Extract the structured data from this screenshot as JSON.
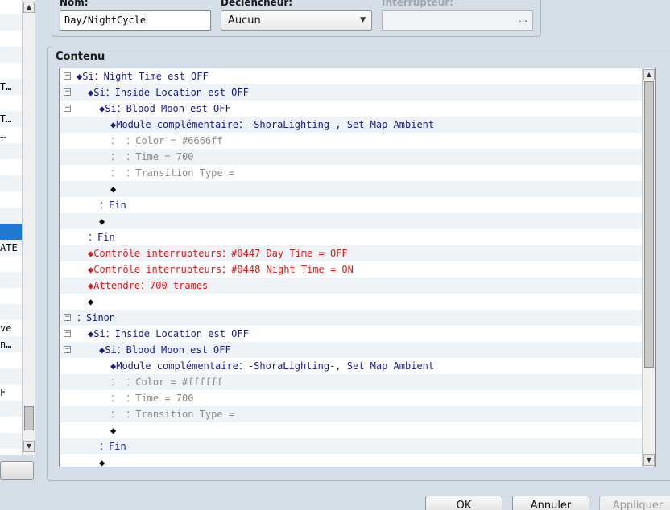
{
  "left_list": {
    "rows": [
      "",
      "",
      "",
      "",
      "",
      "T…",
      "",
      "T…",
      "…",
      "",
      "",
      "",
      "",
      "",
      "",
      "ATE",
      "",
      "",
      "",
      "",
      "ve",
      "n…",
      "",
      "",
      "F",
      "",
      "",
      ""
    ],
    "selected_index": 14
  },
  "fields": {
    "name_label": "Nom:",
    "name_value": "Day/NightCycle",
    "trigger_label": "Déclencheur:",
    "trigger_value": "Aucun",
    "switch_label": "Interrupteur:",
    "switch_button": "…"
  },
  "content": {
    "title": "Contenu",
    "rows": [
      {
        "fold": "minus",
        "fold_indent": 0,
        "text_indent": 0,
        "color": "blue",
        "text": "◆Si：Night Time est OFF"
      },
      {
        "fold": "minus",
        "fold_indent": 0,
        "text_indent": 1,
        "color": "blue",
        "text": "◆Si：Inside Location est OFF"
      },
      {
        "fold": "minus",
        "fold_indent": 0,
        "text_indent": 2,
        "color": "blue",
        "text": "◆Si：Blood Moon est OFF"
      },
      {
        "fold": "",
        "text_indent": 3,
        "color": "blue",
        "text": "◆Module complémentaire：-ShoraLighting-, Set Map Ambient"
      },
      {
        "fold": "",
        "text_indent": 3,
        "color": "gray",
        "text": "：                      ：Color = #6666ff"
      },
      {
        "fold": "",
        "text_indent": 3,
        "color": "gray",
        "text": "：                      ：Time = 700"
      },
      {
        "fold": "",
        "text_indent": 3,
        "color": "gray",
        "text": "：                      ：Transition Type ="
      },
      {
        "fold": "",
        "text_indent": 3,
        "color": "black",
        "text": "◆"
      },
      {
        "fold": "",
        "text_indent": 2,
        "color": "blue",
        "text": "：Fin"
      },
      {
        "fold": "",
        "text_indent": 2,
        "color": "black",
        "text": "◆"
      },
      {
        "fold": "",
        "text_indent": 1,
        "color": "blue",
        "text": "：Fin"
      },
      {
        "fold": "",
        "text_indent": 1,
        "color": "red",
        "text": "◆Contrôle interrupteurs：#0447 Day Time = OFF"
      },
      {
        "fold": "",
        "text_indent": 1,
        "color": "red",
        "text": "◆Contrôle interrupteurs：#0448 Night Time = ON"
      },
      {
        "fold": "",
        "text_indent": 1,
        "color": "red",
        "text": "◆Attendre：700 trames"
      },
      {
        "fold": "",
        "text_indent": 1,
        "color": "black",
        "text": "◆"
      },
      {
        "fold": "minus",
        "fold_indent": 0,
        "text_indent": 0,
        "color": "blue",
        "text": "：Sinon"
      },
      {
        "fold": "minus",
        "fold_indent": 0,
        "text_indent": 1,
        "color": "blue",
        "text": "◆Si：Inside Location est OFF"
      },
      {
        "fold": "minus",
        "fold_indent": 0,
        "text_indent": 2,
        "color": "blue",
        "text": "◆Si：Blood Moon est OFF"
      },
      {
        "fold": "",
        "text_indent": 3,
        "color": "blue",
        "text": "◆Module complémentaire：-ShoraLighting-, Set Map Ambient"
      },
      {
        "fold": "",
        "text_indent": 3,
        "color": "gray",
        "text": "：                      ：Color = #ffffff"
      },
      {
        "fold": "",
        "text_indent": 3,
        "color": "gray",
        "text": "：                      ：Time = 700"
      },
      {
        "fold": "",
        "text_indent": 3,
        "color": "gray",
        "text": "：                      ：Transition Type ="
      },
      {
        "fold": "",
        "text_indent": 3,
        "color": "black",
        "text": "◆"
      },
      {
        "fold": "",
        "text_indent": 2,
        "color": "blue",
        "text": "：Fin"
      },
      {
        "fold": "",
        "text_indent": 2,
        "color": "black",
        "text": "◆"
      }
    ]
  },
  "buttons": {
    "ok": "OK",
    "cancel": "Annuler",
    "apply": "Appliquer"
  },
  "colors": {
    "blue": "#1a1a8c",
    "red": "#d81b1b",
    "gray": "#8a8a8a",
    "selection": "#1f78d1"
  }
}
